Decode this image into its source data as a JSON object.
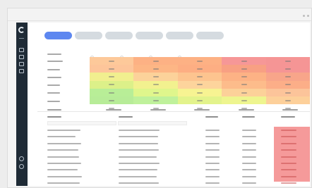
{
  "window": {
    "controls": [
      "minimize-dot",
      "close-dot"
    ]
  },
  "sidebar": {
    "icons": [
      "app-logo-icon",
      "menu-icon",
      "report-icon",
      "settings-icon",
      "chat-icon",
      "document-icon",
      "help-icon",
      "user-icon"
    ]
  },
  "tabs": {
    "count": 6,
    "active_index": 0
  },
  "heatmap": {
    "rows": 7,
    "cols": 5,
    "colors": [
      [
        "#fdc99a",
        "#fdb184",
        "#fdb184",
        "#f69797",
        "#f59595"
      ],
      [
        "#fdc59a",
        "#fdb685",
        "#fdae83",
        "#f8a083",
        "#f59595"
      ],
      [
        "#f1ef8f",
        "#fcd29a",
        "#fdc48f",
        "#fdb285",
        "#f8a58a"
      ],
      [
        "#dcf089",
        "#f2f18f",
        "#fdd49c",
        "#fdbc8b",
        "#fcae88"
      ],
      [
        "#b8ee97",
        "#dff68c",
        "#f7f392",
        "#fcd199",
        "#fcc49a"
      ],
      [
        "#b7ec98",
        "#bff19b",
        "#e3f38c",
        "#eef58f",
        "#fdd09a"
      ],
      [
        "#ffffff",
        "#ffffff",
        "#ffffff",
        "#ffffff",
        "#ffffff"
      ]
    ]
  },
  "table": {
    "rows": 9,
    "highlight_color": "#f59a9a"
  }
}
